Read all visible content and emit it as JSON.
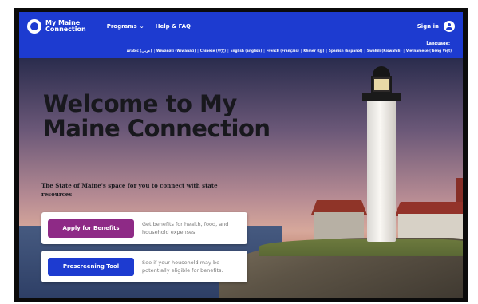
{
  "header": {
    "logo_text": "My Maine\nConnection",
    "nav": [
      {
        "label": "Programs",
        "has_dropdown": true
      },
      {
        "label": "Help & FAQ",
        "has_dropdown": false
      }
    ],
    "signin_label": "Sign in",
    "brand_color": "#1d3bd0"
  },
  "language_bar": {
    "label": "Language:",
    "languages": [
      "Arabic (عربي)",
      "Wiwanati (Wiwanati)",
      "Chinese (中文)",
      "English (English)",
      "French (Français)",
      "Khmer (ខ្មែរ)",
      "Spanish (Español)",
      "Swahili (Kiswahili)",
      "Vietnamese (Tiếng Việt)"
    ]
  },
  "hero": {
    "title": "Welcome to My Maine Connection",
    "subtitle": "The State of Maine's space for you to connect with state resources"
  },
  "cards": [
    {
      "button_label": "Apply for Benefits",
      "description": "Get benefits for health, food, and household expenses.",
      "button_color": "#8e2a86"
    },
    {
      "button_label": "Prescreening Tool",
      "description": "See if your household may be potentially eligible for benefits.",
      "button_color": "#1d3bd0"
    }
  ]
}
